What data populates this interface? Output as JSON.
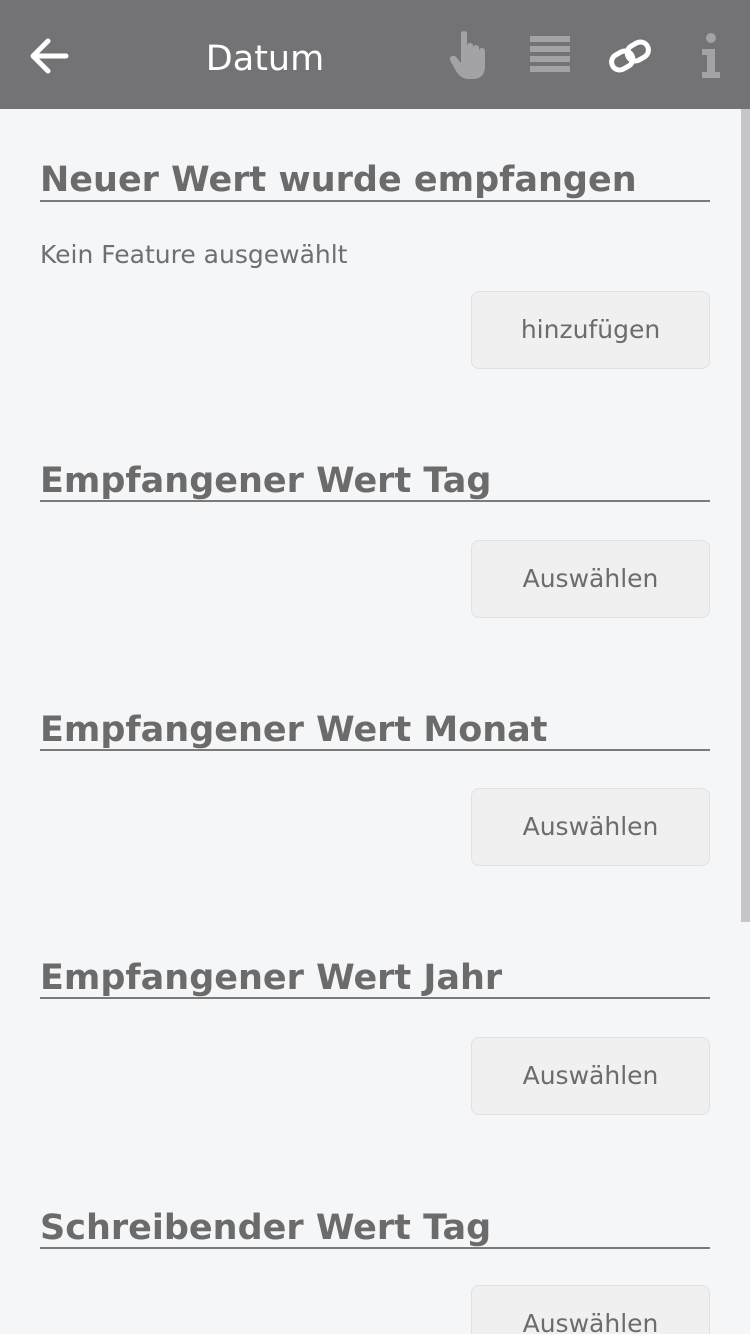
{
  "header": {
    "title": "Datum",
    "icons": [
      "back-arrow-icon",
      "hand-pointer-icon",
      "list-icon",
      "link-icon",
      "info-icon"
    ]
  },
  "sections": [
    {
      "title": "Neuer Wert wurde empfangen",
      "note": "Kein Feature ausgewählt",
      "button": "hinzufügen"
    },
    {
      "title": "Empfangener Wert Tag",
      "button": "Auswählen"
    },
    {
      "title": "Empfangener Wert Monat",
      "button": "Auswählen"
    },
    {
      "title": "Empfangener Wert Jahr",
      "button": "Auswählen"
    },
    {
      "title": "Schreibender Wert Tag",
      "button": "Auswählen"
    }
  ],
  "colors": {
    "topbar": "#737375",
    "background": "#f5f6f8",
    "text": "#6f6f6f",
    "button_bg": "#f0f0f1"
  }
}
